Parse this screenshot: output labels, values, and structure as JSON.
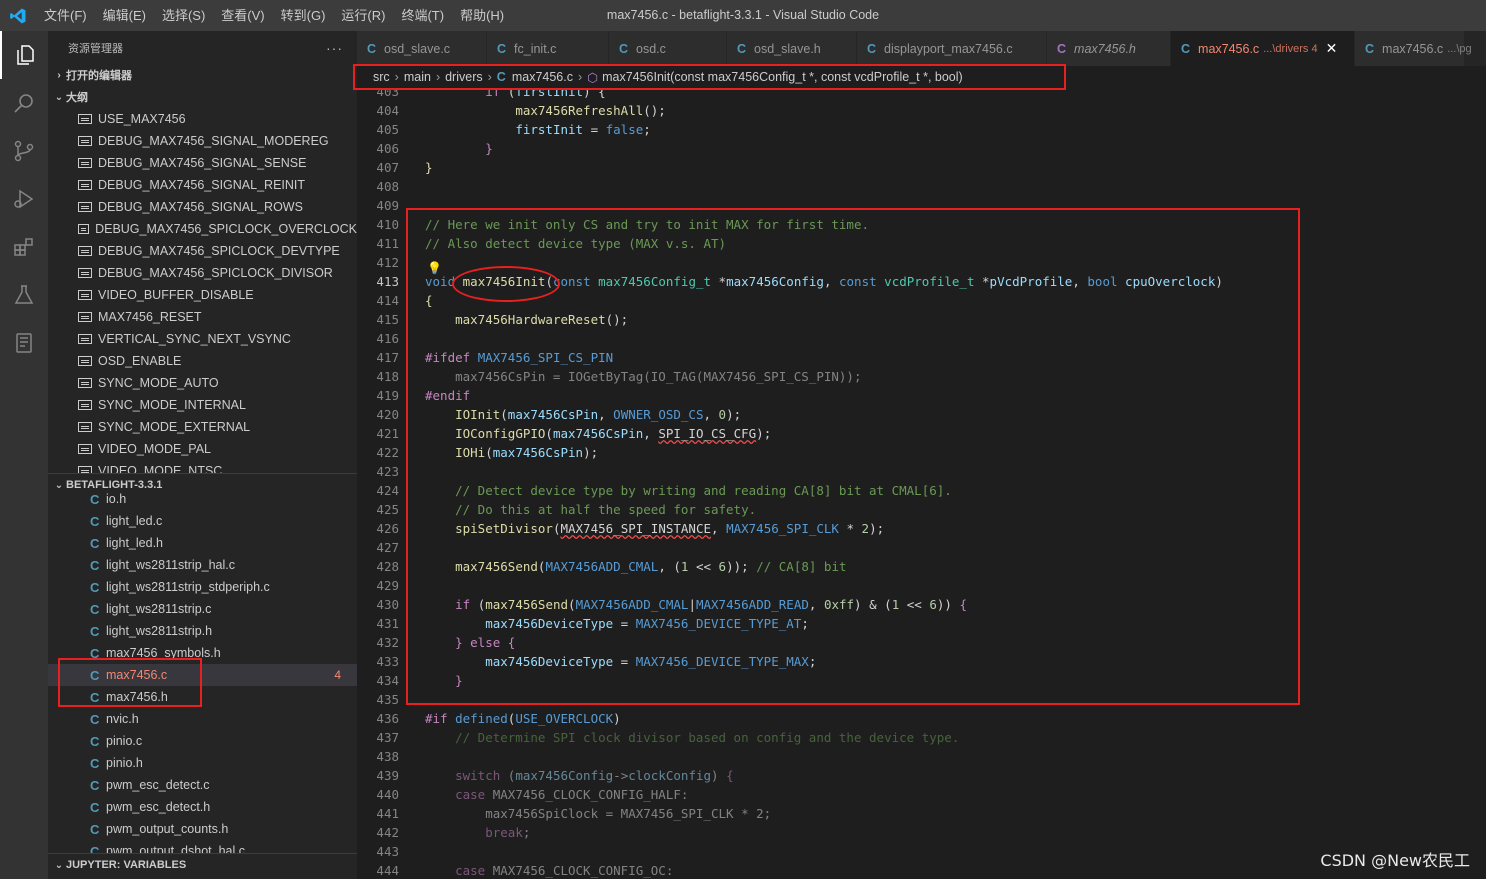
{
  "window": {
    "title": "max7456.c - betaflight-3.3.1 - Visual Studio Code"
  },
  "menu": [
    "文件(F)",
    "编辑(E)",
    "选择(S)",
    "查看(V)",
    "转到(G)",
    "运行(R)",
    "终端(T)",
    "帮助(H)"
  ],
  "activity_bar": [
    "explorer-icon",
    "search-icon",
    "source-control-icon",
    "run-debug-icon",
    "extensions-icon",
    "testing-icon",
    "notebook-icon"
  ],
  "sidebar": {
    "title": "资源管理器",
    "more": "···",
    "open_editors": "打开的编辑器",
    "outline_title": "大纲",
    "outline_items": [
      "USE_MAX7456",
      "DEBUG_MAX7456_SIGNAL_MODEREG",
      "DEBUG_MAX7456_SIGNAL_SENSE",
      "DEBUG_MAX7456_SIGNAL_REINIT",
      "DEBUG_MAX7456_SIGNAL_ROWS",
      "DEBUG_MAX7456_SPICLOCK_OVERCLOCK",
      "DEBUG_MAX7456_SPICLOCK_DEVTYPE",
      "DEBUG_MAX7456_SPICLOCK_DIVISOR",
      "VIDEO_BUFFER_DISABLE",
      "MAX7456_RESET",
      "VERTICAL_SYNC_NEXT_VSYNC",
      "OSD_ENABLE",
      "SYNC_MODE_AUTO",
      "SYNC_MODE_INTERNAL",
      "SYNC_MODE_EXTERNAL",
      "VIDEO_MODE_PAL",
      "VIDEO_MODE_NTSC"
    ],
    "project_title": "BETAFLIGHT-3.3.1",
    "files": [
      {
        "name": "io.h",
        "count": ""
      },
      {
        "name": "light_led.c",
        "count": ""
      },
      {
        "name": "light_led.h",
        "count": ""
      },
      {
        "name": "light_ws2811strip_hal.c",
        "count": ""
      },
      {
        "name": "light_ws2811strip_stdperiph.c",
        "count": ""
      },
      {
        "name": "light_ws2811strip.c",
        "count": ""
      },
      {
        "name": "light_ws2811strip.h",
        "count": ""
      },
      {
        "name": "max7456_symbols.h",
        "count": ""
      },
      {
        "name": "max7456.c",
        "count": "4"
      },
      {
        "name": "max7456.h",
        "count": ""
      },
      {
        "name": "nvic.h",
        "count": ""
      },
      {
        "name": "pinio.c",
        "count": ""
      },
      {
        "name": "pinio.h",
        "count": ""
      },
      {
        "name": "pwm_esc_detect.c",
        "count": ""
      },
      {
        "name": "pwm_esc_detect.h",
        "count": ""
      },
      {
        "name": "pwm_output_counts.h",
        "count": ""
      },
      {
        "name": "pwm_output_dshot_hal.c",
        "count": ""
      }
    ],
    "jupyter_title": "JUPYTER: VARIABLES"
  },
  "tabs": [
    {
      "label": "osd_slave.c",
      "desc": "",
      "active": false,
      "italic": false
    },
    {
      "label": "fc_init.c",
      "desc": "",
      "active": false,
      "italic": false
    },
    {
      "label": "osd.c",
      "desc": "",
      "active": false,
      "italic": false
    },
    {
      "label": "osd_slave.h",
      "desc": "",
      "active": false,
      "italic": false
    },
    {
      "label": "displayport_max7456.c",
      "desc": "",
      "active": false,
      "italic": false
    },
    {
      "label": "max7456.h",
      "desc": "",
      "active": false,
      "italic": true
    },
    {
      "label": "max7456.c",
      "desc": "...\\drivers 4",
      "active": true,
      "italic": false
    },
    {
      "label": "max7456.c",
      "desc": "...\\pg",
      "active": false,
      "italic": false
    }
  ],
  "breadcrumb": [
    "src",
    "main",
    "drivers",
    "max7456.c",
    "max7456Init(const max7456Config_t *, const vcdProfile_t *, bool)"
  ],
  "editor": {
    "lines": [
      {
        "n": "403",
        "html": "        <span class='ctl'>if</span> (<span class='var'>firstInit</span>) {"
      },
      {
        "n": "404",
        "html": "            <span class='fn'>max7456RefreshAll</span>();"
      },
      {
        "n": "405",
        "html": "            <span class='var'>firstInit</span> = <span class='kw'>false</span>;"
      },
      {
        "n": "406",
        "html": "        <span class='ctl'>}</span>"
      },
      {
        "n": "407",
        "html": "<span class='fn'>}</span>"
      },
      {
        "n": "408",
        "html": ""
      },
      {
        "n": "409",
        "html": ""
      },
      {
        "n": "410",
        "html": "<span class='cmt'>// Here we init only CS and try to init MAX for first time.</span>"
      },
      {
        "n": "411",
        "html": "<span class='cmt'>// Also detect device type (MAX v.s. AT)</span>"
      },
      {
        "n": "412",
        "html": ""
      },
      {
        "n": "413",
        "html": "<span class='kw'>void</span> <span class='fn'>max7456Init</span>(<span class='kw'>const</span> <span class='typ'>max7456Config_t</span> *<span class='var'>max7456Config</span>, <span class='kw'>const</span> <span class='typ'>vcdProfile_t</span> *<span class='var'>pVcdProfile</span>, <span class='kw'>bool</span> <span class='var'>cpuOverclock</span>)"
      },
      {
        "n": "414",
        "html": "<span class='fn'>{</span>"
      },
      {
        "n": "415",
        "html": "    <span class='fn'>max7456HardwareReset</span>();"
      },
      {
        "n": "416",
        "html": ""
      },
      {
        "n": "417",
        "html": "<span class='pp'>#ifdef</span> <span class='mac'>MAX7456_SPI_CS_PIN</span>"
      },
      {
        "n": "418",
        "html": "<span class='dim'>    max7456CsPin = IOGetByTag(IO_TAG(MAX7456_SPI_CS_PIN));</span>"
      },
      {
        "n": "419",
        "html": "<span class='pp'>#endif</span>"
      },
      {
        "n": "420",
        "html": "    <span class='fn'>IOInit</span>(<span class='var'>max7456CsPin</span>, <span class='mac'>OWNER_OSD_CS</span>, <span class='num'>0</span>);"
      },
      {
        "n": "421",
        "html": "    <span class='fn'>IOConfigGPIO</span>(<span class='var'>max7456CsPin</span>, <span class='sq'>SPI_IO_CS_CFG</span>);"
      },
      {
        "n": "422",
        "html": "    <span class='fn'>IOHi</span>(<span class='var'>max7456CsPin</span>);"
      },
      {
        "n": "423",
        "html": ""
      },
      {
        "n": "424",
        "html": "    <span class='cmt'>// Detect device type by writing and reading CA[8] bit at CMAL[6].</span>"
      },
      {
        "n": "425",
        "html": "    <span class='cmt'>// Do this at half the speed for safety.</span>"
      },
      {
        "n": "426",
        "html": "    <span class='fn'>spiSetDivisor</span>(<span class='sq'>MAX7456_SPI_INSTANCE</span>, <span class='mac'>MAX7456_SPI_CLK</span> * <span class='num'>2</span>);"
      },
      {
        "n": "427",
        "html": ""
      },
      {
        "n": "428",
        "html": "    <span class='fn'>max7456Send</span>(<span class='mac'>MAX7456ADD_CMAL</span>, (<span class='num'>1</span> &lt;&lt; <span class='num'>6</span>)); <span class='cmt'>// CA[8] bit</span>"
      },
      {
        "n": "429",
        "html": ""
      },
      {
        "n": "430",
        "html": "    <span class='ctl'>if</span> (<span class='fn'>max7456Send</span>(<span class='mac'>MAX7456ADD_CMAL</span>|<span class='mac'>MAX7456ADD_READ</span>, <span class='num'>0xff</span>) &amp; (<span class='num'>1</span> &lt;&lt; <span class='num'>6</span>)) <span class='ctl'>{</span>"
      },
      {
        "n": "431",
        "html": "        <span class='var'>max7456DeviceType</span> = <span class='mac'>MAX7456_DEVICE_TYPE_AT</span>;"
      },
      {
        "n": "432",
        "html": "    <span class='ctl'>} else {</span>"
      },
      {
        "n": "433",
        "html": "        <span class='var'>max7456DeviceType</span> = <span class='mac'>MAX7456_DEVICE_TYPE_MAX</span>;"
      },
      {
        "n": "434",
        "html": "    <span class='ctl'>}</span>"
      },
      {
        "n": "435",
        "html": ""
      },
      {
        "n": "436",
        "html": "<span class='pp'>#if</span> <span class='kw'>defined</span>(<span class='mac'>USE_OVERCLOCK</span>)"
      },
      {
        "n": "437",
        "html": "<span class='dim'><span class='cmt'>    // Determine SPI clock divisor based on config and the device type.</span></span>"
      },
      {
        "n": "438",
        "html": ""
      },
      {
        "n": "439",
        "html": "<span class='dim'>    <span class='ctl'>switch</span> (<span class='var'>max7456Config</span>-&gt;<span class='var'>clockConfig</span>) <span class='ctl'>{</span></span>"
      },
      {
        "n": "440",
        "html": "<span class='dim'>    <span class='ctl'>case</span> MAX7456_CLOCK_CONFIG_HALF:</span>"
      },
      {
        "n": "441",
        "html": "<span class='dim'>        max7456SpiClock = MAX7456_SPI_CLK * 2;</span>"
      },
      {
        "n": "442",
        "html": "<span class='dim'>        <span class='ctl'>break</span>;</span>"
      },
      {
        "n": "443",
        "html": ""
      },
      {
        "n": "444",
        "html": "<span class='dim'>    <span class='ctl'>case</span> MAX7456_CLOCK_CONFIG_OC:</span>"
      }
    ],
    "current_line": "413"
  },
  "watermark": "CSDN @New农民工",
  "colors": {
    "annotation": "#e82020",
    "titlebar": "#3c3c3c",
    "activitybar": "#333333",
    "sidebar": "#252526",
    "editor": "#1e1e1e"
  }
}
